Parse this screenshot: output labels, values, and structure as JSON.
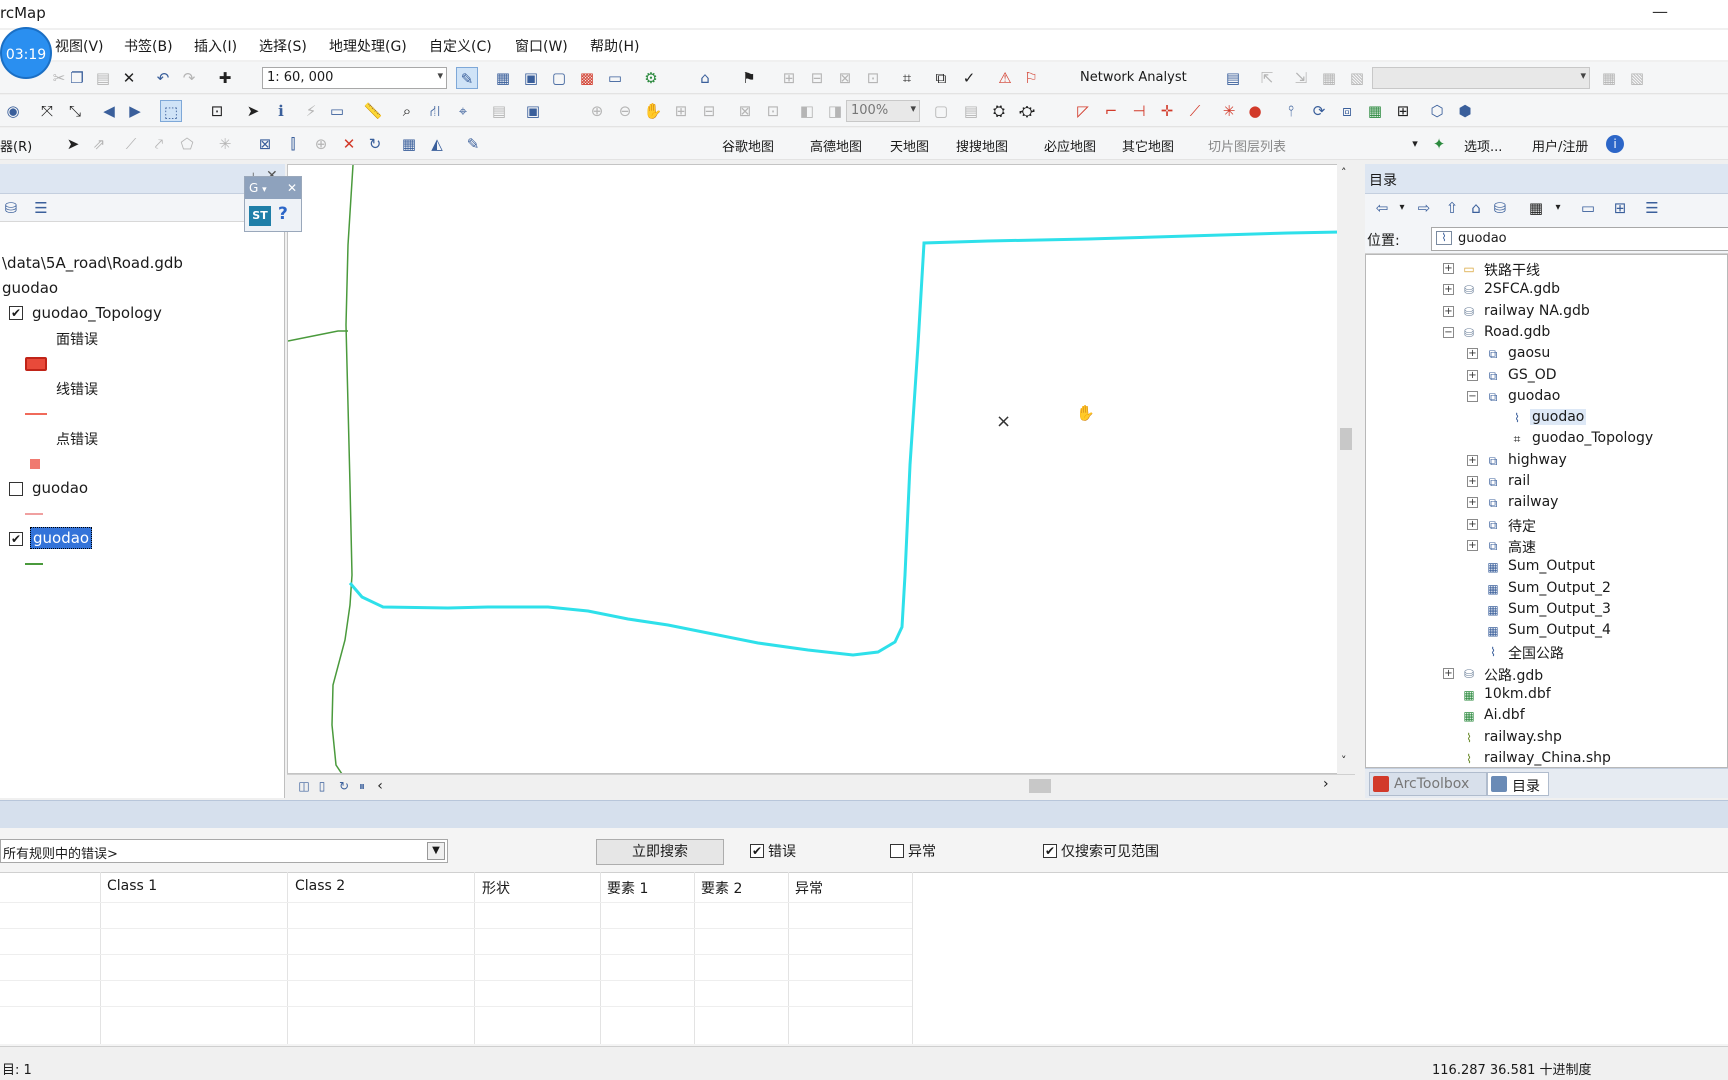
{
  "window": {
    "title": "rcMap",
    "minimize": "—"
  },
  "timer": "03:19",
  "menu": [
    "视图(V)",
    "书签(B)",
    "插入(I)",
    "选择(S)",
    "地理处理(G)",
    "自定义(C)",
    "窗口(W)",
    "帮助(H)"
  ],
  "toolbar": {
    "scale": "1: 60, 000",
    "network_analyst": "Network Analyst",
    "zoom_percent": "100%",
    "editor_menu": "器(R)",
    "basemaps": [
      "谷歌地图",
      "高德地图",
      "天地图",
      "搜搜地图",
      "必应地图",
      "其它地图"
    ],
    "tile_layer_list": "切片图层列表",
    "options": "选项...",
    "register": "用户/注册"
  },
  "toc": {
    "source": "\\data\\5A_road\\Road.gdb",
    "dataset": "guodao",
    "layers": [
      {
        "name": "guodao_Topology",
        "checked": "✔"
      },
      {
        "name": "guodao",
        "checked": ""
      },
      {
        "name": "guodao",
        "checked": "✔",
        "selected": true
      }
    ],
    "legend": {
      "polygon_errors": "面错误",
      "line_errors": "线错误",
      "point_errors": "点错误"
    }
  },
  "float_toolbar": {
    "title": "G",
    "st": "ST",
    "help": "?"
  },
  "catalog": {
    "title": "目录",
    "location_label": "位置:",
    "location_value": "guodao",
    "tree": [
      {
        "label": "铁路干线",
        "kind": "folder",
        "exp": "+",
        "level": 0
      },
      {
        "label": "2SFCA.gdb",
        "kind": "gdb",
        "exp": "+",
        "level": 0
      },
      {
        "label": "railway NA.gdb",
        "kind": "gdb",
        "exp": "+",
        "level": 0
      },
      {
        "label": "Road.gdb",
        "kind": "gdb",
        "exp": "−",
        "level": 0
      },
      {
        "label": "gaosu",
        "kind": "dataset",
        "exp": "+",
        "level": 1
      },
      {
        "label": "GS_OD",
        "kind": "dataset",
        "exp": "+",
        "level": 1
      },
      {
        "label": "guodao",
        "kind": "dataset",
        "exp": "−",
        "level": 1
      },
      {
        "label": "guodao",
        "kind": "line",
        "exp": "",
        "level": 2,
        "selected": true
      },
      {
        "label": "guodao_Topology",
        "kind": "topology",
        "exp": "",
        "level": 2
      },
      {
        "label": "highway",
        "kind": "dataset",
        "exp": "+",
        "level": 1
      },
      {
        "label": "rail",
        "kind": "dataset",
        "exp": "+",
        "level": 1
      },
      {
        "label": "railway",
        "kind": "dataset",
        "exp": "+",
        "level": 1
      },
      {
        "label": "待定",
        "kind": "dataset",
        "exp": "+",
        "level": 1
      },
      {
        "label": "高速",
        "kind": "dataset",
        "exp": "+",
        "level": 1
      },
      {
        "label": "Sum_Output",
        "kind": "table",
        "exp": "",
        "level": 1
      },
      {
        "label": "Sum_Output_2",
        "kind": "table",
        "exp": "",
        "level": 1
      },
      {
        "label": "Sum_Output_3",
        "kind": "table",
        "exp": "",
        "level": 1
      },
      {
        "label": "Sum_Output_4",
        "kind": "table",
        "exp": "",
        "level": 1
      },
      {
        "label": "全国公路",
        "kind": "line",
        "exp": "",
        "level": 1
      },
      {
        "label": "公路.gdb",
        "kind": "gdb",
        "exp": "+",
        "level": 0
      },
      {
        "label": "10km.dbf",
        "kind": "dbf",
        "exp": "",
        "level": 0
      },
      {
        "label": "Ai.dbf",
        "kind": "dbf",
        "exp": "",
        "level": 0
      },
      {
        "label": "railway.shp",
        "kind": "shp",
        "exp": "",
        "level": 0
      },
      {
        "label": "railway_China.shp",
        "kind": "shp",
        "exp": "",
        "level": 0
      }
    ],
    "tabs": [
      "ArcToolbox",
      "目录"
    ]
  },
  "error_inspector": {
    "filter": "所有规则中的错误>",
    "search_button": "立即搜索",
    "errors": {
      "label": "错误",
      "checked": "✔"
    },
    "exceptions": {
      "label": "异常",
      "checked": ""
    },
    "visible_extent": {
      "label": "仅搜索可见范围",
      "checked": "✔"
    },
    "columns": [
      "",
      "Class 1",
      "Class 2",
      "形状",
      "要素 1",
      "要素 2",
      "异常"
    ]
  },
  "status": {
    "left": "目: 1",
    "coords": "116.287  36.581 十进制度"
  },
  "colors": {
    "selected_line": "#2ee0ea",
    "green_road": "#4a9a3c",
    "topology_error": "#e84a3a",
    "selection": "#3373d9"
  }
}
